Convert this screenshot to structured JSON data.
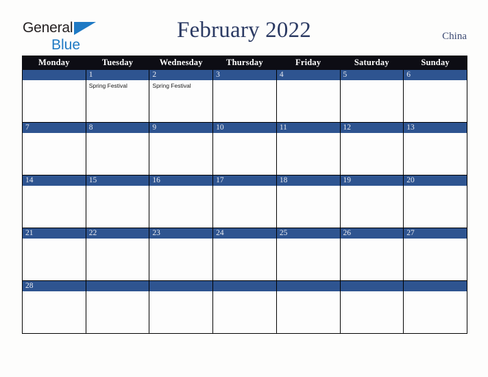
{
  "brand": {
    "line1": "General",
    "line2": "Blue",
    "accent_color": "#1f7ac4"
  },
  "header": {
    "title": "February 2022",
    "region": "China",
    "title_color": "#2b3a63"
  },
  "colors": {
    "header_row_bg": "#0d0d14",
    "date_band_bg": "#2e5490",
    "cell_bg": "#fdfdfd",
    "page_bg": "#fdfdfc",
    "grid_line": "#000000"
  },
  "calendar": {
    "weekday_headers": [
      "Monday",
      "Tuesday",
      "Wednesday",
      "Thursday",
      "Friday",
      "Saturday",
      "Sunday"
    ],
    "weeks": [
      [
        {
          "day": "",
          "events": []
        },
        {
          "day": "1",
          "events": [
            "Spring Festival"
          ]
        },
        {
          "day": "2",
          "events": [
            "Spring Festival"
          ]
        },
        {
          "day": "3",
          "events": []
        },
        {
          "day": "4",
          "events": []
        },
        {
          "day": "5",
          "events": []
        },
        {
          "day": "6",
          "events": []
        }
      ],
      [
        {
          "day": "7",
          "events": []
        },
        {
          "day": "8",
          "events": []
        },
        {
          "day": "9",
          "events": []
        },
        {
          "day": "10",
          "events": []
        },
        {
          "day": "11",
          "events": []
        },
        {
          "day": "12",
          "events": []
        },
        {
          "day": "13",
          "events": []
        }
      ],
      [
        {
          "day": "14",
          "events": []
        },
        {
          "day": "15",
          "events": []
        },
        {
          "day": "16",
          "events": []
        },
        {
          "day": "17",
          "events": []
        },
        {
          "day": "18",
          "events": []
        },
        {
          "day": "19",
          "events": []
        },
        {
          "day": "20",
          "events": []
        }
      ],
      [
        {
          "day": "21",
          "events": []
        },
        {
          "day": "22",
          "events": []
        },
        {
          "day": "23",
          "events": []
        },
        {
          "day": "24",
          "events": []
        },
        {
          "day": "25",
          "events": []
        },
        {
          "day": "26",
          "events": []
        },
        {
          "day": "27",
          "events": []
        }
      ],
      [
        {
          "day": "28",
          "events": []
        },
        {
          "day": "",
          "events": []
        },
        {
          "day": "",
          "events": []
        },
        {
          "day": "",
          "events": []
        },
        {
          "day": "",
          "events": []
        },
        {
          "day": "",
          "events": []
        },
        {
          "day": "",
          "events": []
        }
      ]
    ]
  }
}
